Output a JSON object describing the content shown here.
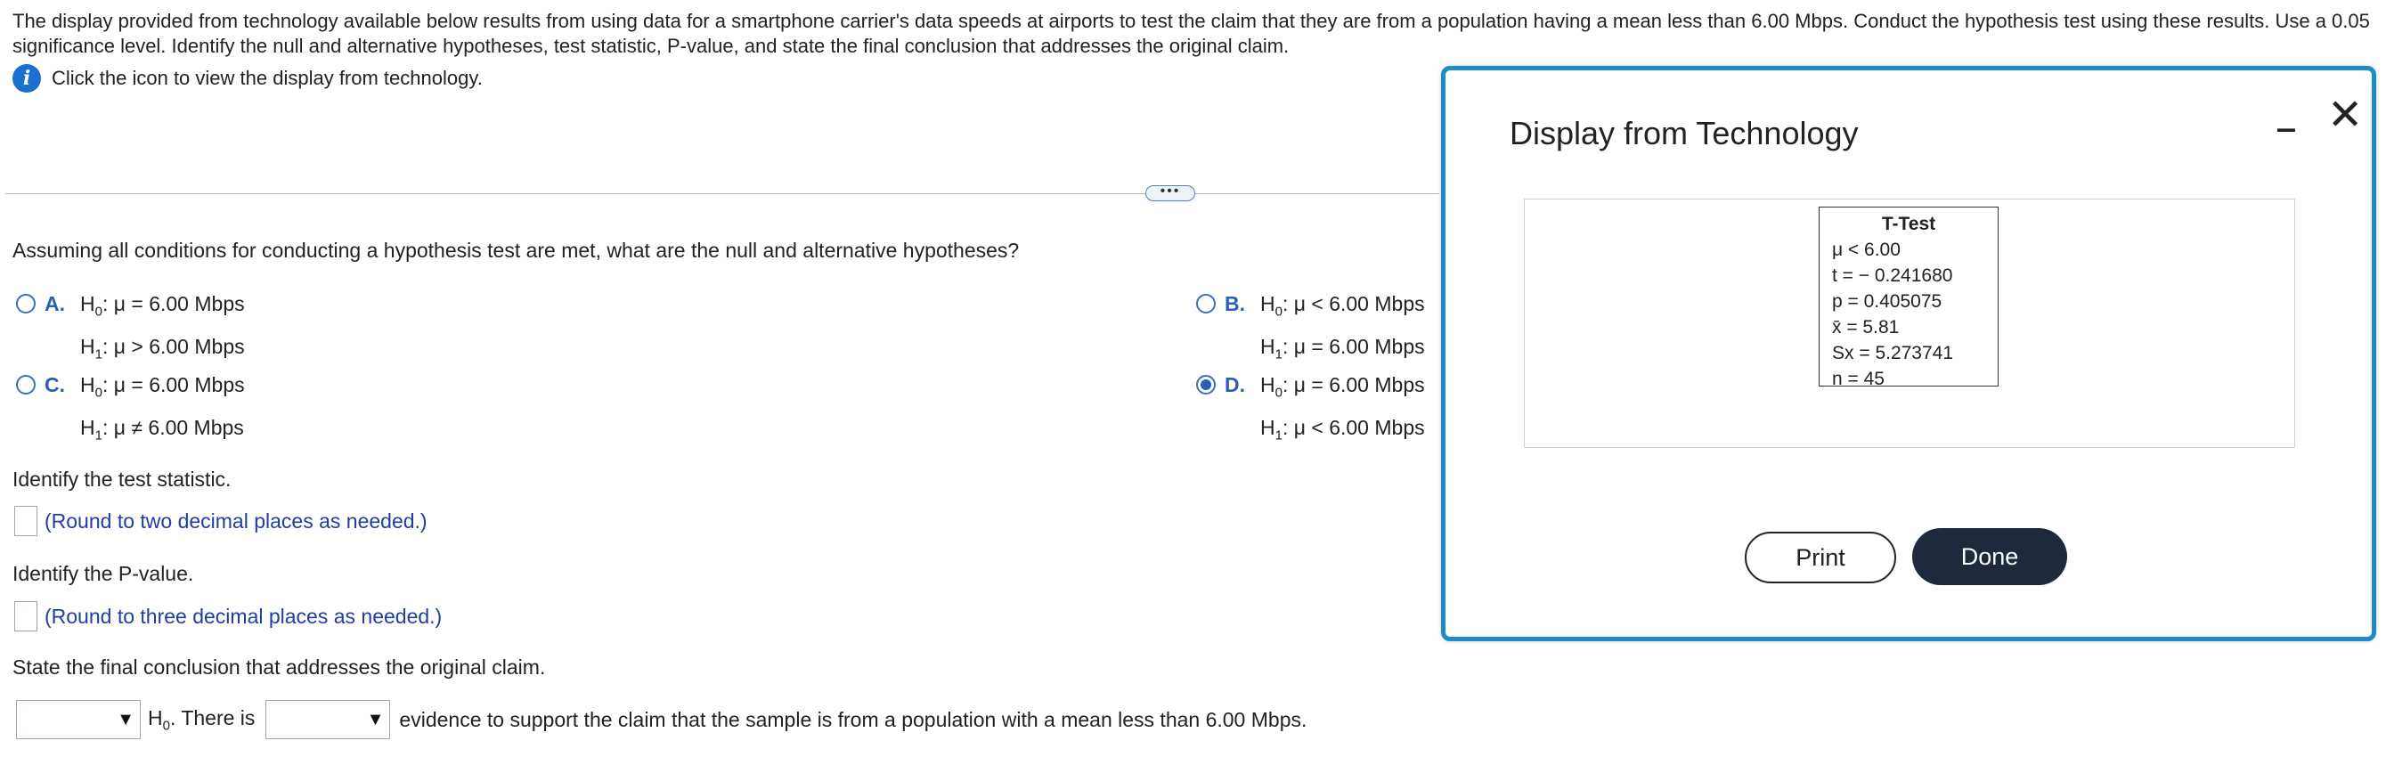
{
  "prompt": "The display provided from technology available below results from using data for a smartphone carrier's data speeds at airports to test the claim that they are from a population having a mean less than 6.00 Mbps. Conduct the hypothesis test using these results. Use a 0.05 significance level. Identify the null and alternative hypotheses, test statistic, P-value, and state the final conclusion that addresses the original claim.",
  "info_link": "Click the icon to view the display from technology.",
  "more_pill": "•••",
  "question1": "Assuming all conditions for conducting a hypothesis test are met, what are the null and alternative hypotheses?",
  "choices": [
    {
      "letter": "A.",
      "h0_rel": ": μ = 6.00 Mbps",
      "h1_rel": ": μ > 6.00 Mbps",
      "selected": false
    },
    {
      "letter": "B.",
      "h0_rel": ": μ < 6.00 Mbps",
      "h1_rel": ": μ = 6.00 Mbps",
      "selected": false
    },
    {
      "letter": "C.",
      "h0_rel": ": μ = 6.00 Mbps",
      "h1_rel": ": μ ≠ 6.00 Mbps",
      "selected": false
    },
    {
      "letter": "D.",
      "h0_rel": ": μ = 6.00 Mbps",
      "h1_rel": ": μ < 6.00 Mbps",
      "selected": true
    }
  ],
  "question2": "Identify the test statistic.",
  "hint2": "(Round to two decimal places as needed.)",
  "question3": "Identify the P-value.",
  "hint3": "(Round to three decimal places as needed.)",
  "question4": "State the final conclusion that addresses the original claim.",
  "conclusion": {
    "h0": "H",
    "h0_tail": ". There is",
    "tail": "evidence to support the claim that the sample is from a population with a mean less than 6.00 Mbps."
  },
  "dialog": {
    "title": "Display from Technology",
    "minimize": "‒",
    "close": "✕",
    "ttest": {
      "title": "T-Test",
      "lines": [
        "μ < 6.00",
        "t = − 0.241680",
        "p = 0.405075",
        "x̄ = 5.81",
        "Sx = 5.273741",
        "n = 45"
      ]
    },
    "print": "Print",
    "done": "Done"
  },
  "colors": {
    "accent": "#2a5fb8",
    "dialog_border": "#1c8cc6",
    "done_bg": "#1e2a3c",
    "hint_text": "#1f3fa0"
  }
}
